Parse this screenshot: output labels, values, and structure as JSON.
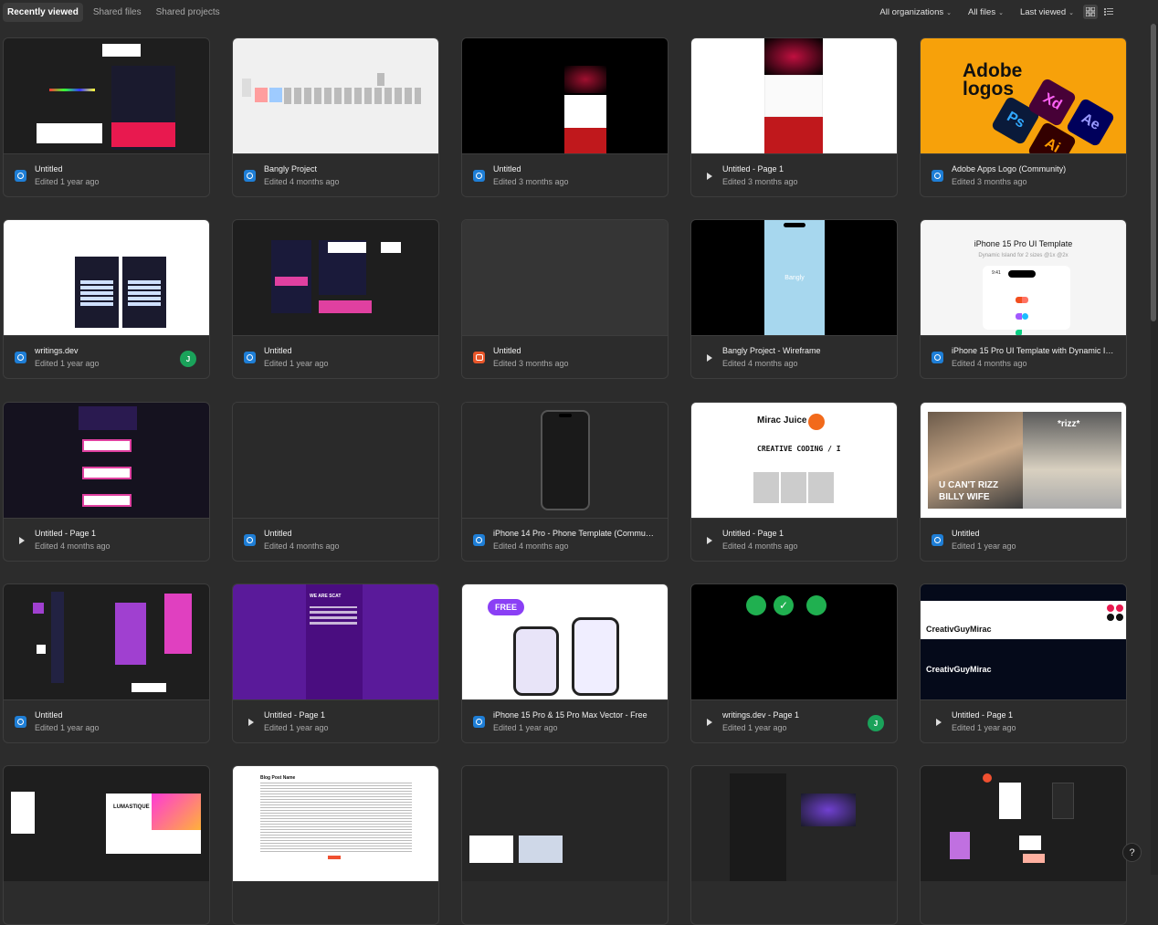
{
  "tabs": [
    {
      "label": "Recently viewed",
      "active": true
    },
    {
      "label": "Shared files",
      "active": false
    },
    {
      "label": "Shared projects",
      "active": false
    }
  ],
  "filters": {
    "organizations": "All organizations",
    "files": "All files",
    "sort": "Last viewed"
  },
  "view_icons": [
    "grid-view-icon",
    "list-view-icon"
  ],
  "colors": {
    "background": "#2c2c2c",
    "design_icon": "#1e7ed6",
    "figjam_icon": "#e8562a",
    "avatar": "#1aa25a",
    "adobe_orange": "#f7a10a"
  },
  "files": [
    {
      "title": "Untitled",
      "edited": "Edited 1 year ago",
      "type": "design"
    },
    {
      "title": "Bangly Project",
      "edited": "Edited 4 months ago",
      "type": "design"
    },
    {
      "title": "Untitled",
      "edited": "Edited 3 months ago",
      "type": "design"
    },
    {
      "title": "Untitled - Page 1",
      "edited": "Edited 3 months ago",
      "type": "prototype"
    },
    {
      "title": "Adobe Apps Logo (Community)",
      "edited": "Edited 3 months ago",
      "type": "design"
    },
    {
      "title": "writings.dev",
      "edited": "Edited 1 year ago",
      "type": "design",
      "avatar": "J"
    },
    {
      "title": "Untitled",
      "edited": "Edited 1 year ago",
      "type": "design"
    },
    {
      "title": "Untitled",
      "edited": "Edited 3 months ago",
      "type": "figjam"
    },
    {
      "title": "Bangly Project - Wireframe",
      "edited": "Edited 4 months ago",
      "type": "prototype"
    },
    {
      "title": "iPhone 15 Pro UI Template with Dynamic Island",
      "edited": "Edited 4 months ago",
      "type": "design"
    },
    {
      "title": "Untitled - Page 1",
      "edited": "Edited 4 months ago",
      "type": "prototype"
    },
    {
      "title": "Untitled",
      "edited": "Edited 4 months ago",
      "type": "design"
    },
    {
      "title": "iPhone 14 Pro - Phone Template (Community)",
      "edited": "Edited 4 months ago",
      "type": "design"
    },
    {
      "title": "Untitled - Page 1",
      "edited": "Edited 4 months ago",
      "type": "prototype"
    },
    {
      "title": "Untitled",
      "edited": "Edited 1 year ago",
      "type": "design"
    },
    {
      "title": "Untitled",
      "edited": "Edited 1 year ago",
      "type": "design"
    },
    {
      "title": "Untitled - Page 1",
      "edited": "Edited 1 year ago",
      "type": "prototype"
    },
    {
      "title": "iPhone 15 Pro & 15 Pro Max Vector - Free",
      "edited": "Edited 1 year ago",
      "type": "design"
    },
    {
      "title": "writings.dev - Page 1",
      "edited": "Edited 1 year ago",
      "type": "prototype",
      "avatar": "J"
    },
    {
      "title": "Untitled - Page 1",
      "edited": "Edited 1 year ago",
      "type": "prototype"
    },
    {
      "title": "",
      "edited": "",
      "type": "design"
    },
    {
      "title": "",
      "edited": "",
      "type": "design"
    },
    {
      "title": "",
      "edited": "",
      "type": "design"
    },
    {
      "title": "",
      "edited": "",
      "type": "design"
    },
    {
      "title": "",
      "edited": "",
      "type": "design"
    }
  ],
  "thumb_text": {
    "adobe_title_1": "Adobe",
    "adobe_title_2": "logos",
    "adobe_ps": "Ps",
    "adobe_xd": "Xd",
    "adobe_ai": "Ai",
    "adobe_ae": "Ae",
    "bangly": "Bangly",
    "iphone_template_title": "iPhone 15 Pro UI Template",
    "iphone_template_sub": "Dynamic Island for 2 sizes @1x @2x",
    "iphone_time": "9:41",
    "mirac_juice": "Mirac Juice",
    "creative_coding": "CREATIVE CODING / I",
    "meme_rizz": "*rizz*",
    "meme_caption_1": "U CAN'T RIZZ",
    "meme_caption_2": "BILLY WIFE",
    "free_badge": "FREE",
    "scat_header": "WE ARE SCAT",
    "creativguy_1": "CreativGuyMirac",
    "creativguy_2": "CreativGuyMirac",
    "blog_title": "Blog Post Name",
    "lumastique": "LUMASTIQUE"
  },
  "help_label": "?"
}
